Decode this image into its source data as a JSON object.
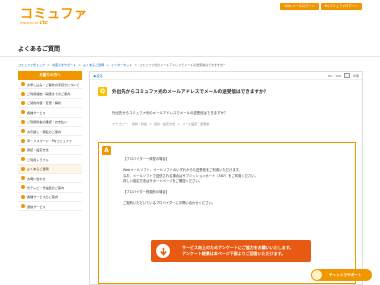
{
  "header": {
    "logo": "コミュファ",
    "logo_sub": "Powered by",
    "logo_brand": "ctc",
    "buttons": [
      "Web メールログイン",
      "Myコミュファログイン"
    ]
  },
  "page_title": "よくあるご質問",
  "breadcrumb": [
    "コミュファ光トップ",
    "お客さまサポート",
    "よくあるご質問",
    "インターネット",
    "コミュファ光のメールアドレスでメールの送受信はできますか？"
  ],
  "sidebar": {
    "heading": "お困りの方へ",
    "items": [
      "お申し込み・ご解約の手続きについて",
      "ご利用開始・開通までのご案内",
      "ご契約内容・変更・解約",
      "各種サービス",
      "ご利用料金の確認・お支払い",
      "お引越し・移転のご案内",
      "ID・パスワード・Myコミュファ",
      "接続・設定方法",
      "ご利用トラブル",
      "よくあるご質問",
      "お問い合わせ",
      "光テレビ・光電話のご案内",
      "各種サービスのご案内",
      "通信サービス"
    ]
  },
  "main": {
    "back": "◀ 戻る",
    "faq_no": "No：706",
    "print": "印刷",
    "question_badge": "Q",
    "question_title": "外出先からコミュファ光のメールアドレスでメールの送受信はできますか？",
    "question_text": "外出先からコミュファ光のメールアドレスでメールの送受信はできますか？",
    "category": [
      "カテゴリー：",
      "契約・料金",
      "＞",
      "接続・設定方法",
      "＞",
      "メール設定・送受信"
    ],
    "answer_badge": "A",
    "answer_lines": [
      "【プロバイダー一体型の場合】",
      "",
      "Webメールソフト、メールソフトのいずれからも送受信をご利用いただけます。",
      "なお、メールソフトで送信される場合はサブミッションポート（587）をご利用ください。",
      "詳しい設定方法はサポートページをご確認ください。",
      "",
      "【プロバイダー別契約の場合】",
      "",
      "ご契約いただいているプロバイダーにお問い合わせください。"
    ],
    "survey_line1": "サービス向上のためアンケートにご協力をお願いいたします。",
    "survey_line2": "アンケート結果は本ページ下部よりご回答いただけます。"
  },
  "chat_label": "チャットでサポート"
}
